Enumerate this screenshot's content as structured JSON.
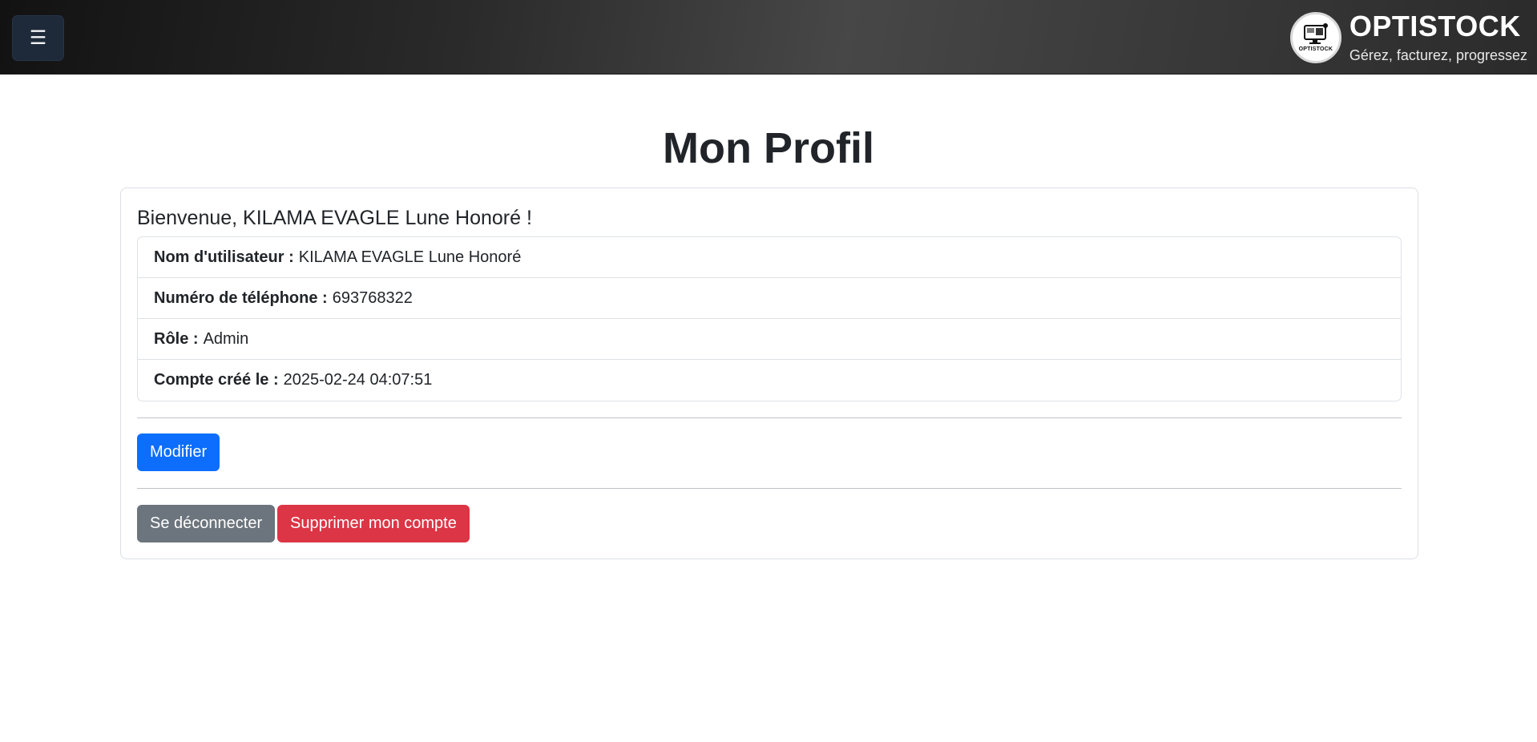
{
  "header": {
    "menu_icon": "hamburger-icon",
    "menu_glyph": "☰",
    "brand_name": "OPTISTOCK",
    "brand_tagline": "Gérez, facturez, progressez",
    "logo_text": "OPTISTOCK"
  },
  "page": {
    "title": "Mon Profil"
  },
  "profile": {
    "welcome": "Bienvenue, KILAMA EVAGLE Lune Honoré !",
    "fields": [
      {
        "label": "Nom d'utilisateur :",
        "value": "KILAMA EVAGLE Lune Honoré"
      },
      {
        "label": "Numéro de téléphone :",
        "value": "693768322"
      },
      {
        "label": "Rôle :",
        "value": "Admin"
      },
      {
        "label": "Compte créé le :",
        "value": "2025-02-24 04:07:51"
      }
    ]
  },
  "actions": {
    "edit_label": "Modifier",
    "logout_label": "Se déconnecter",
    "delete_label": "Supprimer mon compte"
  },
  "colors": {
    "primary": "#0d6efd",
    "secondary": "#6c757d",
    "danger": "#dc3545",
    "menu_button_bg": "#1e2a3a"
  }
}
